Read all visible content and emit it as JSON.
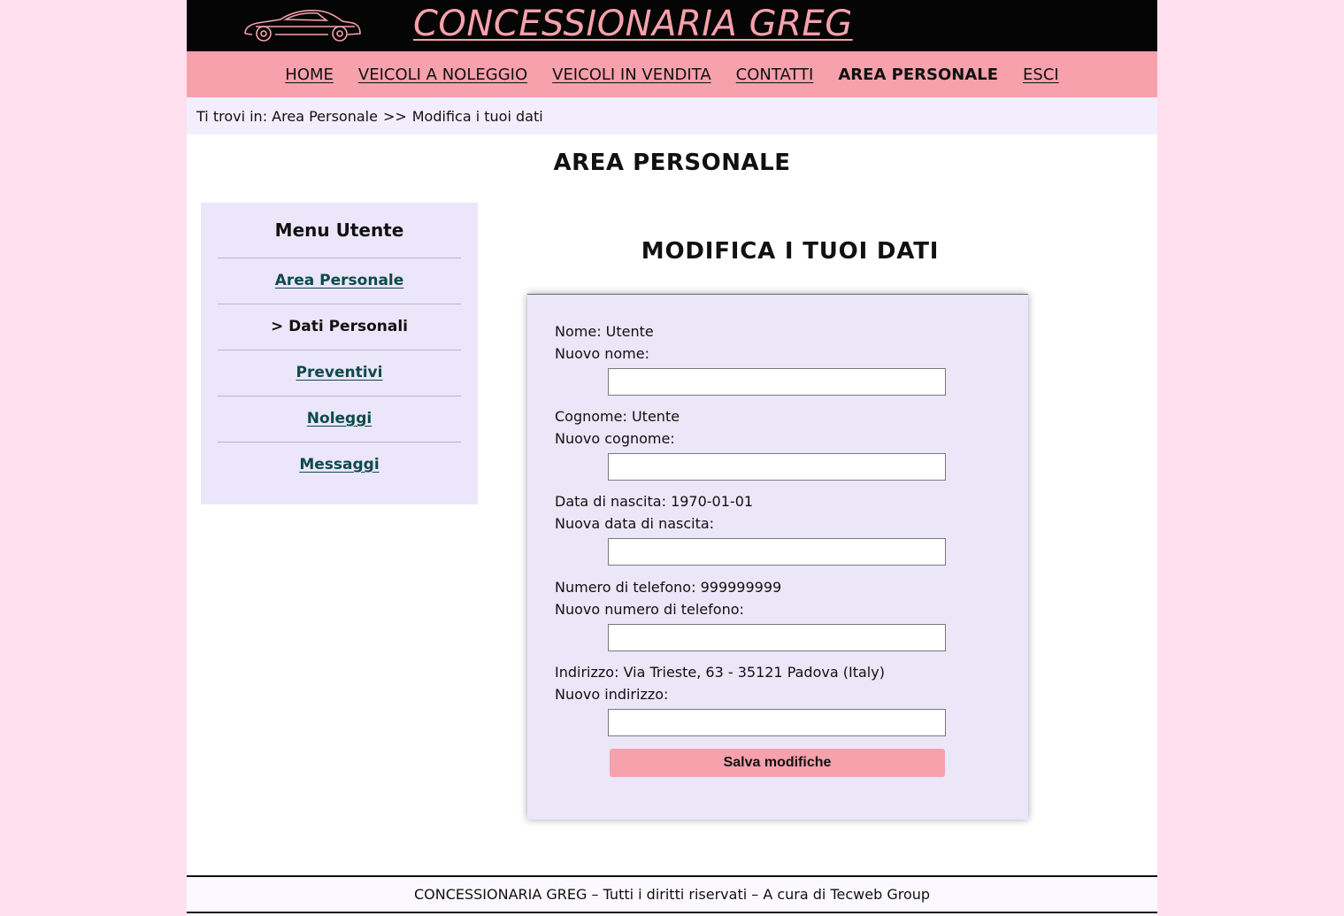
{
  "header": {
    "site_title": "CONCESSIONARIA GREG",
    "logo_icon": "car-icon",
    "accent_color": "#f7a1ac"
  },
  "nav": {
    "items": [
      {
        "label": "HOME"
      },
      {
        "label": "VEICOLI A NOLEGGIO"
      },
      {
        "label": "VEICOLI IN VENDITA"
      },
      {
        "label": "CONTATTI"
      },
      {
        "label": "AREA PERSONALE",
        "current": true
      },
      {
        "label": "ESCI"
      }
    ]
  },
  "breadcrumb": {
    "prefix": "Ti trovi in:",
    "parent": "Area Personale",
    "separator": ">>",
    "current": "Modifica i tuoi dati"
  },
  "page_title": "AREA PERSONALE",
  "side_menu": {
    "title": "Menu Utente",
    "items": [
      {
        "label": "Area Personale"
      },
      {
        "label": "> Dati Personali",
        "current": true
      },
      {
        "label": "Preventivi"
      },
      {
        "label": "Noleggi"
      },
      {
        "label": "Messaggi"
      }
    ]
  },
  "form": {
    "title": "MODIFICA I TUOI DATI",
    "fields": [
      {
        "current_label": "Nome:",
        "current_value": "Utente",
        "new_label": "Nuovo nome:",
        "value": ""
      },
      {
        "current_label": "Cognome:",
        "current_value": "Utente",
        "new_label": "Nuovo cognome:",
        "value": ""
      },
      {
        "current_label": "Data di nascita:",
        "current_value": "1970-01-01",
        "new_label": "Nuova data di nascita:",
        "value": ""
      },
      {
        "current_label": "Numero di telefono:",
        "current_value": "999999999",
        "new_label": "Nuovo numero di telefono:",
        "value": ""
      },
      {
        "current_label": "Indirizzo:",
        "current_value": "Via Trieste, 63 - 35121 Padova (Italy)",
        "new_label": "Nuovo indirizzo:",
        "value": ""
      }
    ],
    "submit_label": "Salva modifiche"
  },
  "footer": {
    "text": "CONCESSIONARIA GREG – Tutti i diritti riservati – A cura di Tecweb Group"
  }
}
